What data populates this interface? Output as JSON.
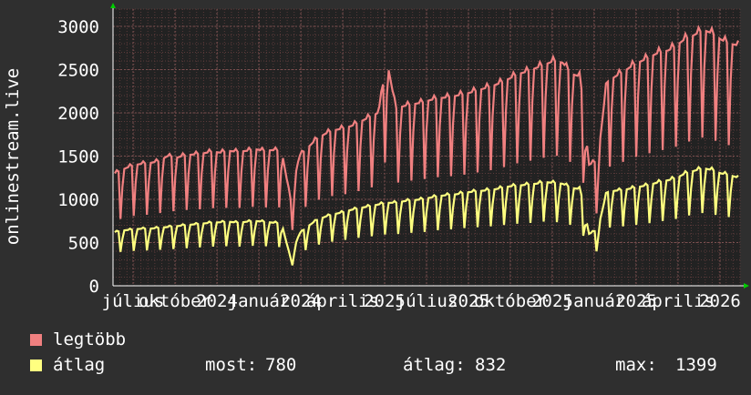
{
  "chart_data": {
    "type": "line",
    "ylabel": "onlinestream.live",
    "ylim": [
      0,
      3200
    ],
    "yticks": [
      0,
      500,
      1000,
      1500,
      2000,
      2500,
      3000
    ],
    "x_ticks": [
      {
        "label": "július",
        "x": "2024-07"
      },
      {
        "label": "október",
        "x": "2024-10"
      },
      {
        "label": "2024",
        "x": "2024"
      },
      {
        "label": "január",
        "x": "2025-01"
      },
      {
        "label": "2024",
        "x": "2024"
      },
      {
        "label": "április",
        "x": "2025-04"
      },
      {
        "label": "2025",
        "x": "2025"
      },
      {
        "label": "július",
        "x": "2025-07"
      },
      {
        "label": "2025",
        "x": "2025"
      },
      {
        "label": "október",
        "x": "2025-10"
      },
      {
        "label": "2025",
        "x": "2025"
      },
      {
        "label": "január",
        "x": "2026-01"
      },
      {
        "label": "2025",
        "x": "2025"
      },
      {
        "label": "április",
        "x": "2026-04"
      },
      {
        "label": "2026",
        "x": "2026"
      }
    ],
    "grid": true,
    "background": "#222222",
    "series": [
      {
        "name": "legtöbb",
        "color": "#f08080",
        "x_range": [
          "2024-07",
          "2026-05"
        ],
        "values": [
          1300,
          1350,
          1390,
          1410,
          1420,
          1440,
          1500,
          1480,
          1510,
          1520,
          1530,
          1550,
          1540,
          1560,
          1550,
          1560,
          1580,
          1560,
          1570,
          1560,
          1000,
          1500,
          1600,
          1700,
          1760,
          1800,
          1820,
          1850,
          1900,
          1950,
          2000,
          2600,
          2050,
          2080,
          2100,
          2120,
          2150,
          2170,
          2180,
          2200,
          2220,
          2250,
          2280,
          2310,
          2350,
          2400,
          2450,
          2480,
          2520,
          2560,
          2600,
          2580,
          2450,
          2420,
          1400,
          1450,
          2350,
          2420,
          2480,
          2550,
          2600,
          2650,
          2700,
          2720,
          2780,
          2860,
          2900,
          2960,
          2920,
          2850,
          2800,
          2780
        ]
      },
      {
        "name": "átlag",
        "color": "#ffff80",
        "x_range": [
          "2024-07",
          "2026-05"
        ],
        "values": [
          620,
          640,
          650,
          660,
          660,
          670,
          680,
          690,
          700,
          710,
          720,
          730,
          735,
          740,
          730,
          740,
          750,
          740,
          730,
          720,
          320,
          600,
          690,
          760,
          800,
          830,
          850,
          880,
          900,
          920,
          940,
          960,
          960,
          980,
          990,
          1000,
          1020,
          1040,
          1050,
          1060,
          1080,
          1090,
          1100,
          1110,
          1130,
          1150,
          1160,
          1170,
          1180,
          1200,
          1190,
          1180,
          1130,
          1120,
          600,
          650,
          1080,
          1100,
          1110,
          1130,
          1150,
          1170,
          1200,
          1220,
          1250,
          1300,
          1330,
          1360,
          1340,
          1300,
          1280,
          1250
        ]
      }
    ]
  },
  "legend": [
    {
      "label": "legtöbb",
      "color": "#f08080"
    },
    {
      "label": "átlag",
      "color": "#ffff80"
    }
  ],
  "stats": {
    "most_label": "most:",
    "most_value": "780",
    "atlag_label": "átlag:",
    "atlag_value": "832",
    "max_label": "max:",
    "max_value": "1399"
  }
}
